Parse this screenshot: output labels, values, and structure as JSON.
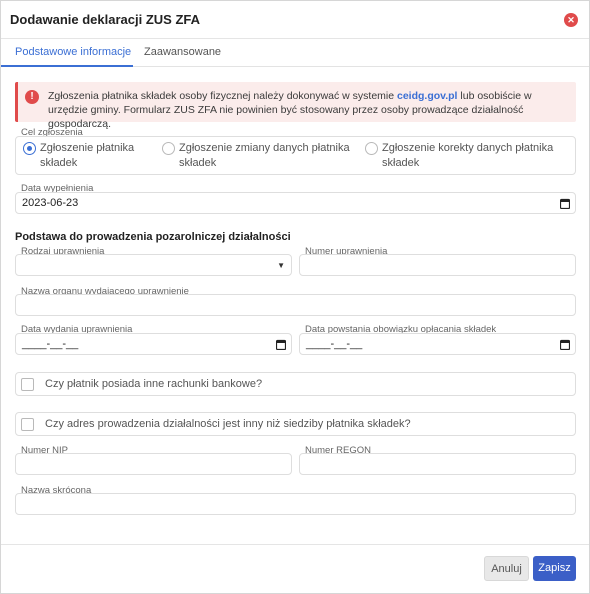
{
  "dialog": {
    "title": "Dodawanie deklaracji ZUS ZFA",
    "close_icon": "close-circle-icon"
  },
  "tabs": [
    {
      "label": "Podstawowe informacje",
      "active": true
    },
    {
      "label": "Zaawansowane",
      "active": false
    }
  ],
  "alert": {
    "icon": "exclamation-icon",
    "text_before": "Zgłoszenia płatnika składek osoby fizycznej należy dokonywać w systemie ",
    "link": "ceidg.gov.pl",
    "text_after": " lub osobiście w urzędzie gminy. Formularz ZUS ZFA nie powinien być stosowany przez osoby prowadzące działalność gospodarczą."
  },
  "cel": {
    "label": "Cel zgłoszenia",
    "options": [
      {
        "label": "Zgłoszenie płatnika składek",
        "checked": true
      },
      {
        "label": "Zgłoszenie zmiany danych płatnika składek",
        "checked": false
      },
      {
        "label": "Zgłoszenie korekty danych płatnika składek",
        "checked": false
      }
    ]
  },
  "data_wypelnienia": {
    "label": "Data wypełnienia",
    "value": "2023-06-23"
  },
  "section_title": "Podstawa do prowadzenia pozarolniczej działalności",
  "rodzaj": {
    "label": "Rodzaj uprawnienia",
    "value": ""
  },
  "numer_uprawnienia": {
    "label": "Numer uprawnienia",
    "value": ""
  },
  "nazwa_organu": {
    "label": "Nazwa organu wydającego uprawnienie",
    "value": ""
  },
  "data_wydania": {
    "label": "Data wydania uprawnienia",
    "value": "____-__-__"
  },
  "data_powstania": {
    "label": "Data powstania obowiązku opłacania składek",
    "value": "____-__-__"
  },
  "checks": [
    {
      "label": "Czy płatnik posiada inne rachunki bankowe?",
      "checked": false
    },
    {
      "label": "Czy adres prowadzenia działalności jest inny niż siedziby płatnika składek?",
      "checked": false
    }
  ],
  "nip": {
    "label": "Numer NIP",
    "value": ""
  },
  "regon": {
    "label": "Numer REGON",
    "value": ""
  },
  "nazwa_skrocona": {
    "label": "Nazwa skrócona",
    "value": ""
  },
  "buttons": {
    "cancel": "Anuluj",
    "save": "Zapisz"
  },
  "colors": {
    "accent": "#3b6fd4",
    "error": "#e04b4b",
    "save": "#3b5fc7"
  }
}
